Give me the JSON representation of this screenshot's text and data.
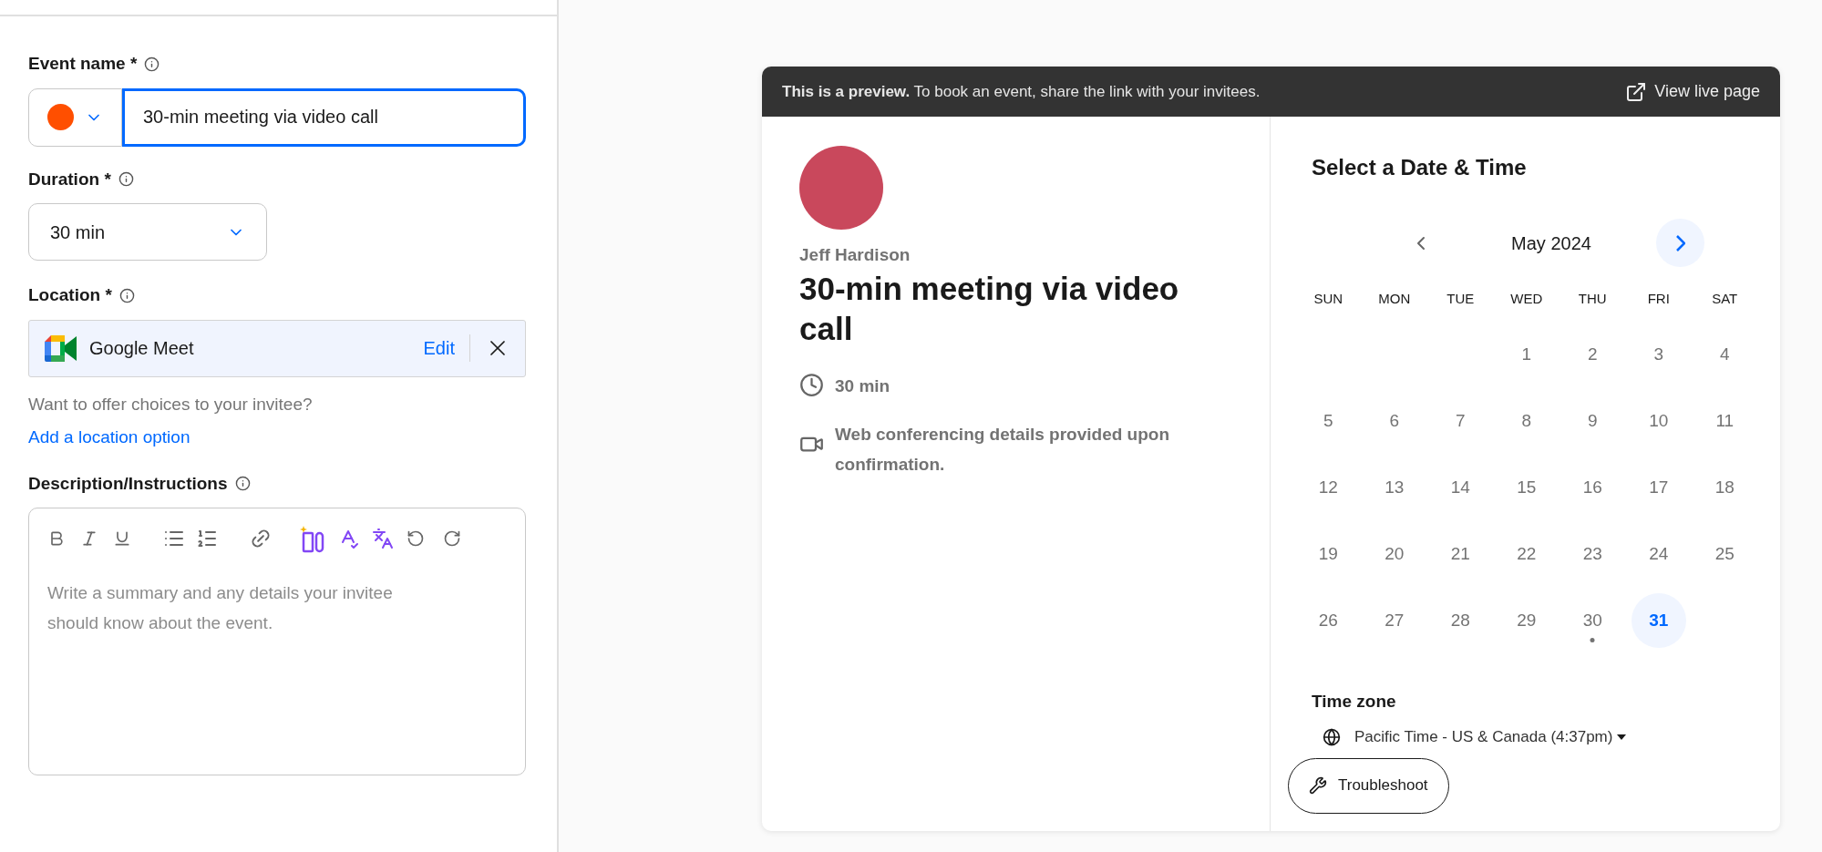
{
  "editor": {
    "event_name": {
      "label": "Event name *",
      "color": "#ff4f00",
      "value": "30-min meeting via video call",
      "focused": true
    },
    "duration": {
      "label": "Duration *",
      "value": "30 min"
    },
    "location": {
      "label": "Location *",
      "value": "Google Meet",
      "edit": "Edit"
    },
    "location_hint": "Want to offer choices to your invitee?",
    "add_location_link": "Add a location option",
    "description": {
      "label": "Description/Instructions",
      "placeholder": "Write a summary and any details your invitee should know about the event."
    }
  },
  "preview": {
    "banner": {
      "text": "**This is a preview.** To book an event, share the link with your invitees.",
      "link": "View live page"
    },
    "host": "Jeff Hardison",
    "title": "30-min meeting via video call",
    "details": [
      {
        "kind": "duration",
        "text": "30 min"
      },
      {
        "kind": "video",
        "text": "Web conferencing details provided upon confirmation."
      }
    ],
    "calendar": {
      "heading": "Select a Date & Time",
      "month": "May 2024",
      "weekdays": [
        "SUN",
        "MON",
        "TUE",
        "WED",
        "THU",
        "FRI",
        "SAT"
      ],
      "weeks": [
        [
          {
            "day": "1",
            "selected": false,
            "today": false
          },
          {
            "day": "2",
            "selected": false,
            "today": false
          },
          {
            "day": "3",
            "selected": false,
            "today": false
          },
          {
            "day": "4",
            "selected": false,
            "today": false
          }
        ],
        [
          {
            "day": "5",
            "selected": false,
            "today": false
          },
          {
            "day": "6",
            "selected": false,
            "today": false
          },
          {
            "day": "7",
            "selected": false,
            "today": false
          },
          {
            "day": "8",
            "selected": false,
            "today": false
          },
          {
            "day": "9",
            "selected": false,
            "today": false
          },
          {
            "day": "10",
            "selected": false,
            "today": false
          },
          {
            "day": "11",
            "selected": false,
            "today": false
          }
        ],
        [
          {
            "day": "12",
            "selected": false,
            "today": false
          },
          {
            "day": "13",
            "selected": false,
            "today": false
          },
          {
            "day": "14",
            "selected": false,
            "today": false
          },
          {
            "day": "15",
            "selected": false,
            "today": false
          },
          {
            "day": "16",
            "selected": false,
            "today": false
          },
          {
            "day": "17",
            "selected": false,
            "today": false
          },
          {
            "day": "18",
            "selected": false,
            "today": false
          }
        ],
        [
          {
            "day": "19",
            "selected": false,
            "today": false
          },
          {
            "day": "20",
            "selected": false,
            "today": false
          },
          {
            "day": "21",
            "selected": false,
            "today": false
          },
          {
            "day": "22",
            "selected": false,
            "today": false
          },
          {
            "day": "23",
            "selected": false,
            "today": false
          },
          {
            "day": "24",
            "selected": false,
            "today": false
          },
          {
            "day": "25",
            "selected": false,
            "today": false
          }
        ],
        [
          {
            "day": "26",
            "selected": false,
            "today": false
          },
          {
            "day": "27",
            "selected": false,
            "today": false
          },
          {
            "day": "28",
            "selected": false,
            "today": false
          },
          {
            "day": "29",
            "selected": false,
            "today": false
          },
          {
            "day": "30",
            "selected": false,
            "today": true
          },
          {
            "day": "31",
            "selected": true,
            "today": false
          }
        ]
      ]
    },
    "timezone": {
      "label": "Time zone",
      "value": "Pacific Time - US & Canada (4:37pm)"
    },
    "troubleshoot": "Troubleshoot"
  }
}
